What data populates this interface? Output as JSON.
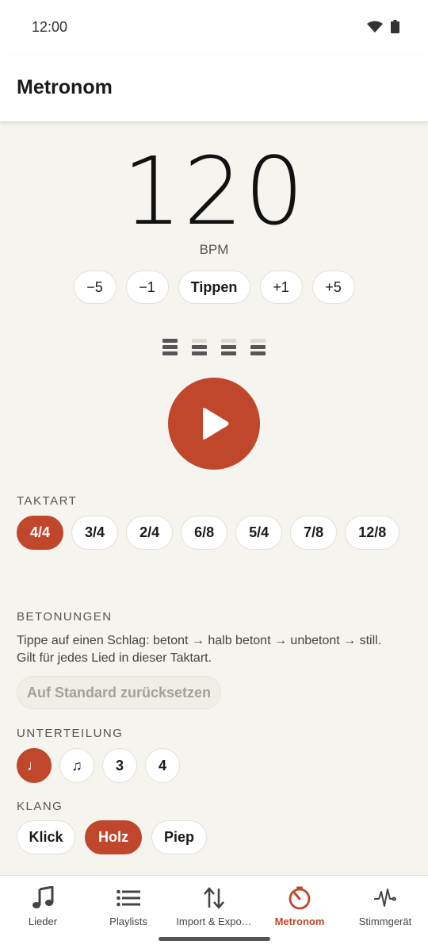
{
  "status_bar": {
    "time": "12:00"
  },
  "app_bar": {
    "title": "Metronom"
  },
  "tempo": {
    "bpm": "120",
    "unit": "BPM"
  },
  "step_buttons": {
    "minus5": "−5",
    "minus1": "−1",
    "tap": "Tippen",
    "plus1": "+1",
    "plus5": "+5"
  },
  "beat_indicator": {
    "beat_count": 4,
    "accent_levels": [
      "accent",
      "half",
      "half",
      "half"
    ]
  },
  "play_button": {
    "icon": "play-icon"
  },
  "time_signature": {
    "label": "TAKTART",
    "options": [
      "4/4",
      "3/4",
      "2/4",
      "6/8",
      "5/4",
      "7/8",
      "12/8"
    ],
    "selected": "4/4"
  },
  "accents": {
    "label": "BETONUNGEN",
    "description": "Tippe auf einen Schlag: betont → halb betont → unbetont → still. Gilt für jedes Lied in dieser Taktart.",
    "reset_label": "Auf Standard zurücksetzen"
  },
  "subdivision": {
    "label": "UNTERTEILUNG",
    "options": [
      "♩",
      "♫",
      "3",
      "4"
    ],
    "selected": "♩"
  },
  "sound": {
    "label": "KLANG",
    "options": [
      "Klick",
      "Holz",
      "Piep"
    ],
    "selected": "Holz"
  },
  "bottom_nav": {
    "items": [
      {
        "label": "Lieder",
        "icon": "music-note-icon"
      },
      {
        "label": "Playlists",
        "icon": "list-icon"
      },
      {
        "label": "Import & Expo…",
        "icon": "import-export-icon"
      },
      {
        "label": "Metronom",
        "icon": "metronome-icon"
      },
      {
        "label": "Stimmgerät",
        "icon": "waveform-icon"
      }
    ],
    "active": "Metronom"
  },
  "colors": {
    "accent": "#c0472b",
    "background": "#f6f4ef",
    "surface": "#ffffff"
  }
}
